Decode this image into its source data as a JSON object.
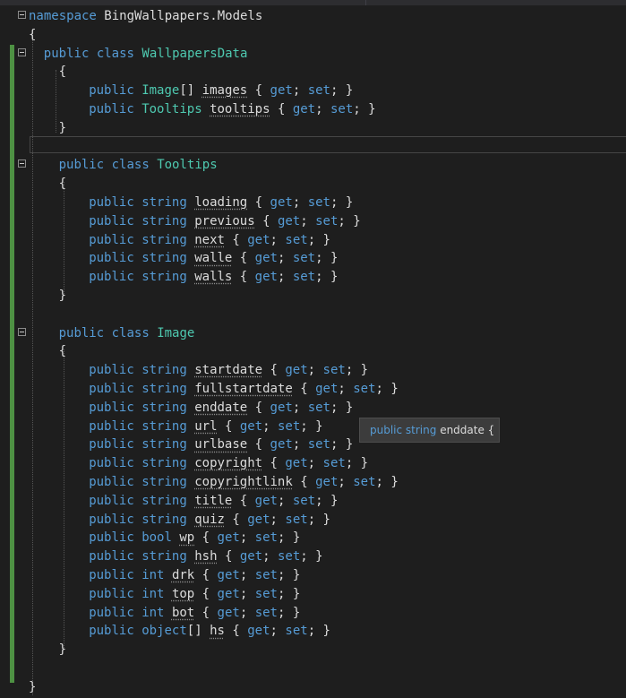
{
  "lines": [
    {
      "i": 0,
      "p": [
        {
          "k": "kw",
          "t": "namespace"
        },
        {
          "t": " BingWallpapers.Models"
        }
      ]
    },
    {
      "i": 0,
      "p": [
        {
          "t": "{"
        }
      ]
    },
    {
      "i": 2,
      "p": [
        {
          "k": "kw",
          "t": "public"
        },
        {
          "t": " "
        },
        {
          "k": "kw",
          "t": "class"
        },
        {
          "t": " "
        },
        {
          "k": "ty",
          "t": "WallpapersData"
        }
      ]
    },
    {
      "i": 4,
      "p": [
        {
          "t": "{"
        }
      ]
    },
    {
      "i": 8,
      "p": [
        {
          "k": "kw",
          "t": "public"
        },
        {
          "t": " "
        },
        {
          "k": "ty",
          "t": "Image"
        },
        {
          "t": "[] "
        },
        {
          "k": "ul",
          "t": "images"
        },
        {
          "t": " { "
        },
        {
          "k": "kw",
          "t": "get"
        },
        {
          "t": "; "
        },
        {
          "k": "kw",
          "t": "set"
        },
        {
          "t": "; }"
        }
      ]
    },
    {
      "i": 8,
      "p": [
        {
          "k": "kw",
          "t": "public"
        },
        {
          "t": " "
        },
        {
          "k": "ty",
          "t": "Tooltips"
        },
        {
          "t": " "
        },
        {
          "k": "ul",
          "t": "tooltips"
        },
        {
          "t": " { "
        },
        {
          "k": "kw",
          "t": "get"
        },
        {
          "t": "; "
        },
        {
          "k": "kw",
          "t": "set"
        },
        {
          "t": "; }"
        }
      ]
    },
    {
      "i": 4,
      "p": [
        {
          "t": "}"
        }
      ]
    },
    {
      "i": 0,
      "p": [
        {
          "t": ""
        }
      ]
    },
    {
      "i": 4,
      "p": [
        {
          "k": "kw",
          "t": "public"
        },
        {
          "t": " "
        },
        {
          "k": "kw",
          "t": "class"
        },
        {
          "t": " "
        },
        {
          "k": "ty",
          "t": "Tooltips"
        }
      ]
    },
    {
      "i": 4,
      "p": [
        {
          "t": "{"
        }
      ]
    },
    {
      "i": 8,
      "p": [
        {
          "k": "kw",
          "t": "public"
        },
        {
          "t": " "
        },
        {
          "k": "kw",
          "t": "string"
        },
        {
          "t": " "
        },
        {
          "k": "ul",
          "t": "loading"
        },
        {
          "t": " { "
        },
        {
          "k": "kw",
          "t": "get"
        },
        {
          "t": "; "
        },
        {
          "k": "kw",
          "t": "set"
        },
        {
          "t": "; }"
        }
      ]
    },
    {
      "i": 8,
      "p": [
        {
          "k": "kw",
          "t": "public"
        },
        {
          "t": " "
        },
        {
          "k": "kw",
          "t": "string"
        },
        {
          "t": " "
        },
        {
          "k": "ul",
          "t": "previous"
        },
        {
          "t": " { "
        },
        {
          "k": "kw",
          "t": "get"
        },
        {
          "t": "; "
        },
        {
          "k": "kw",
          "t": "set"
        },
        {
          "t": "; }"
        }
      ]
    },
    {
      "i": 8,
      "p": [
        {
          "k": "kw",
          "t": "public"
        },
        {
          "t": " "
        },
        {
          "k": "kw",
          "t": "string"
        },
        {
          "t": " "
        },
        {
          "k": "ul",
          "t": "next"
        },
        {
          "t": " { "
        },
        {
          "k": "kw",
          "t": "get"
        },
        {
          "t": "; "
        },
        {
          "k": "kw",
          "t": "set"
        },
        {
          "t": "; }"
        }
      ]
    },
    {
      "i": 8,
      "p": [
        {
          "k": "kw",
          "t": "public"
        },
        {
          "t": " "
        },
        {
          "k": "kw",
          "t": "string"
        },
        {
          "t": " "
        },
        {
          "k": "ul",
          "t": "walle"
        },
        {
          "t": " { "
        },
        {
          "k": "kw",
          "t": "get"
        },
        {
          "t": "; "
        },
        {
          "k": "kw",
          "t": "set"
        },
        {
          "t": "; }"
        }
      ]
    },
    {
      "i": 8,
      "p": [
        {
          "k": "kw",
          "t": "public"
        },
        {
          "t": " "
        },
        {
          "k": "kw",
          "t": "string"
        },
        {
          "t": " "
        },
        {
          "k": "ul",
          "t": "walls"
        },
        {
          "t": " { "
        },
        {
          "k": "kw",
          "t": "get"
        },
        {
          "t": "; "
        },
        {
          "k": "kw",
          "t": "set"
        },
        {
          "t": "; }"
        }
      ]
    },
    {
      "i": 4,
      "p": [
        {
          "t": "}"
        }
      ]
    },
    {
      "i": 0,
      "p": [
        {
          "t": ""
        }
      ]
    },
    {
      "i": 4,
      "p": [
        {
          "k": "kw",
          "t": "public"
        },
        {
          "t": " "
        },
        {
          "k": "kw",
          "t": "class"
        },
        {
          "t": " "
        },
        {
          "k": "ty",
          "t": "Image"
        }
      ]
    },
    {
      "i": 4,
      "p": [
        {
          "t": "{"
        }
      ]
    },
    {
      "i": 8,
      "p": [
        {
          "k": "kw",
          "t": "public"
        },
        {
          "t": " "
        },
        {
          "k": "kw",
          "t": "string"
        },
        {
          "t": " "
        },
        {
          "k": "ul",
          "t": "startdate"
        },
        {
          "t": " { "
        },
        {
          "k": "kw",
          "t": "get"
        },
        {
          "t": "; "
        },
        {
          "k": "kw",
          "t": "set"
        },
        {
          "t": "; }"
        }
      ]
    },
    {
      "i": 8,
      "p": [
        {
          "k": "kw",
          "t": "public"
        },
        {
          "t": " "
        },
        {
          "k": "kw",
          "t": "string"
        },
        {
          "t": " "
        },
        {
          "k": "ul",
          "t": "fullstartdate"
        },
        {
          "t": " { "
        },
        {
          "k": "kw",
          "t": "get"
        },
        {
          "t": "; "
        },
        {
          "k": "kw",
          "t": "set"
        },
        {
          "t": "; }"
        }
      ]
    },
    {
      "i": 8,
      "p": [
        {
          "k": "kw",
          "t": "public"
        },
        {
          "t": " "
        },
        {
          "k": "kw",
          "t": "string"
        },
        {
          "t": " "
        },
        {
          "k": "ul",
          "t": "enddate"
        },
        {
          "t": " { "
        },
        {
          "k": "kw",
          "t": "get"
        },
        {
          "t": "; "
        },
        {
          "k": "kw",
          "t": "set"
        },
        {
          "t": "; }"
        }
      ]
    },
    {
      "i": 8,
      "p": [
        {
          "k": "kw",
          "t": "public"
        },
        {
          "t": " "
        },
        {
          "k": "kw",
          "t": "string"
        },
        {
          "t": " "
        },
        {
          "k": "ul",
          "t": "url"
        },
        {
          "t": " { "
        },
        {
          "k": "kw",
          "t": "get"
        },
        {
          "t": "; "
        },
        {
          "k": "kw",
          "t": "set"
        },
        {
          "t": "; }"
        }
      ]
    },
    {
      "i": 8,
      "p": [
        {
          "k": "kw",
          "t": "public"
        },
        {
          "t": " "
        },
        {
          "k": "kw",
          "t": "string"
        },
        {
          "t": " "
        },
        {
          "k": "ul",
          "t": "urlbase"
        },
        {
          "t": " { "
        },
        {
          "k": "kw",
          "t": "get"
        },
        {
          "t": "; "
        },
        {
          "k": "kw",
          "t": "set"
        },
        {
          "t": "; }"
        }
      ]
    },
    {
      "i": 8,
      "p": [
        {
          "k": "kw",
          "t": "public"
        },
        {
          "t": " "
        },
        {
          "k": "kw",
          "t": "string"
        },
        {
          "t": " "
        },
        {
          "k": "ul",
          "t": "copyright"
        },
        {
          "t": " { "
        },
        {
          "k": "kw",
          "t": "get"
        },
        {
          "t": "; "
        },
        {
          "k": "kw",
          "t": "set"
        },
        {
          "t": "; }"
        }
      ]
    },
    {
      "i": 8,
      "p": [
        {
          "k": "kw",
          "t": "public"
        },
        {
          "t": " "
        },
        {
          "k": "kw",
          "t": "string"
        },
        {
          "t": " "
        },
        {
          "k": "ul",
          "t": "copyrightlink"
        },
        {
          "t": " { "
        },
        {
          "k": "kw",
          "t": "get"
        },
        {
          "t": "; "
        },
        {
          "k": "kw",
          "t": "set"
        },
        {
          "t": "; }"
        }
      ]
    },
    {
      "i": 8,
      "p": [
        {
          "k": "kw",
          "t": "public"
        },
        {
          "t": " "
        },
        {
          "k": "kw",
          "t": "string"
        },
        {
          "t": " "
        },
        {
          "k": "ul",
          "t": "title"
        },
        {
          "t": " { "
        },
        {
          "k": "kw",
          "t": "get"
        },
        {
          "t": "; "
        },
        {
          "k": "kw",
          "t": "set"
        },
        {
          "t": "; }"
        }
      ]
    },
    {
      "i": 8,
      "p": [
        {
          "k": "kw",
          "t": "public"
        },
        {
          "t": " "
        },
        {
          "k": "kw",
          "t": "string"
        },
        {
          "t": " "
        },
        {
          "k": "ul",
          "t": "quiz"
        },
        {
          "t": " { "
        },
        {
          "k": "kw",
          "t": "get"
        },
        {
          "t": "; "
        },
        {
          "k": "kw",
          "t": "set"
        },
        {
          "t": "; }"
        }
      ]
    },
    {
      "i": 8,
      "p": [
        {
          "k": "kw",
          "t": "public"
        },
        {
          "t": " "
        },
        {
          "k": "kw",
          "t": "bool"
        },
        {
          "t": " "
        },
        {
          "k": "ul",
          "t": "wp"
        },
        {
          "t": " { "
        },
        {
          "k": "kw",
          "t": "get"
        },
        {
          "t": "; "
        },
        {
          "k": "kw",
          "t": "set"
        },
        {
          "t": "; }"
        }
      ]
    },
    {
      "i": 8,
      "p": [
        {
          "k": "kw",
          "t": "public"
        },
        {
          "t": " "
        },
        {
          "k": "kw",
          "t": "string"
        },
        {
          "t": " "
        },
        {
          "k": "ul",
          "t": "hsh"
        },
        {
          "t": " { "
        },
        {
          "k": "kw",
          "t": "get"
        },
        {
          "t": "; "
        },
        {
          "k": "kw",
          "t": "set"
        },
        {
          "t": "; }"
        }
      ]
    },
    {
      "i": 8,
      "p": [
        {
          "k": "kw",
          "t": "public"
        },
        {
          "t": " "
        },
        {
          "k": "kw",
          "t": "int"
        },
        {
          "t": " "
        },
        {
          "k": "ul",
          "t": "drk"
        },
        {
          "t": " { "
        },
        {
          "k": "kw",
          "t": "get"
        },
        {
          "t": "; "
        },
        {
          "k": "kw",
          "t": "set"
        },
        {
          "t": "; }"
        }
      ]
    },
    {
      "i": 8,
      "p": [
        {
          "k": "kw",
          "t": "public"
        },
        {
          "t": " "
        },
        {
          "k": "kw",
          "t": "int"
        },
        {
          "t": " "
        },
        {
          "k": "ul",
          "t": "top"
        },
        {
          "t": " { "
        },
        {
          "k": "kw",
          "t": "get"
        },
        {
          "t": "; "
        },
        {
          "k": "kw",
          "t": "set"
        },
        {
          "t": "; }"
        }
      ]
    },
    {
      "i": 8,
      "p": [
        {
          "k": "kw",
          "t": "public"
        },
        {
          "t": " "
        },
        {
          "k": "kw",
          "t": "int"
        },
        {
          "t": " "
        },
        {
          "k": "ul",
          "t": "bot"
        },
        {
          "t": " { "
        },
        {
          "k": "kw",
          "t": "get"
        },
        {
          "t": "; "
        },
        {
          "k": "kw",
          "t": "set"
        },
        {
          "t": "; }"
        }
      ]
    },
    {
      "i": 8,
      "p": [
        {
          "k": "kw",
          "t": "public"
        },
        {
          "t": " "
        },
        {
          "k": "kw",
          "t": "object"
        },
        {
          "t": "[] "
        },
        {
          "k": "ul",
          "t": "hs"
        },
        {
          "t": " { "
        },
        {
          "k": "kw",
          "t": "get"
        },
        {
          "t": "; "
        },
        {
          "k": "kw",
          "t": "set"
        },
        {
          "t": "; }"
        }
      ]
    },
    {
      "i": 4,
      "p": [
        {
          "t": "}"
        }
      ]
    },
    {
      "i": 0,
      "p": [
        {
          "t": ""
        }
      ]
    },
    {
      "i": 0,
      "p": [
        {
          "t": "}"
        }
      ]
    }
  ],
  "tooltip": {
    "kw": "public string",
    "rest": " enddate {"
  },
  "colors": {
    "background": "#1e1e1e",
    "keyword": "#569cd6",
    "type": "#4ec9b0",
    "text": "#dcdcdc",
    "change_bar": "#57a64a"
  }
}
